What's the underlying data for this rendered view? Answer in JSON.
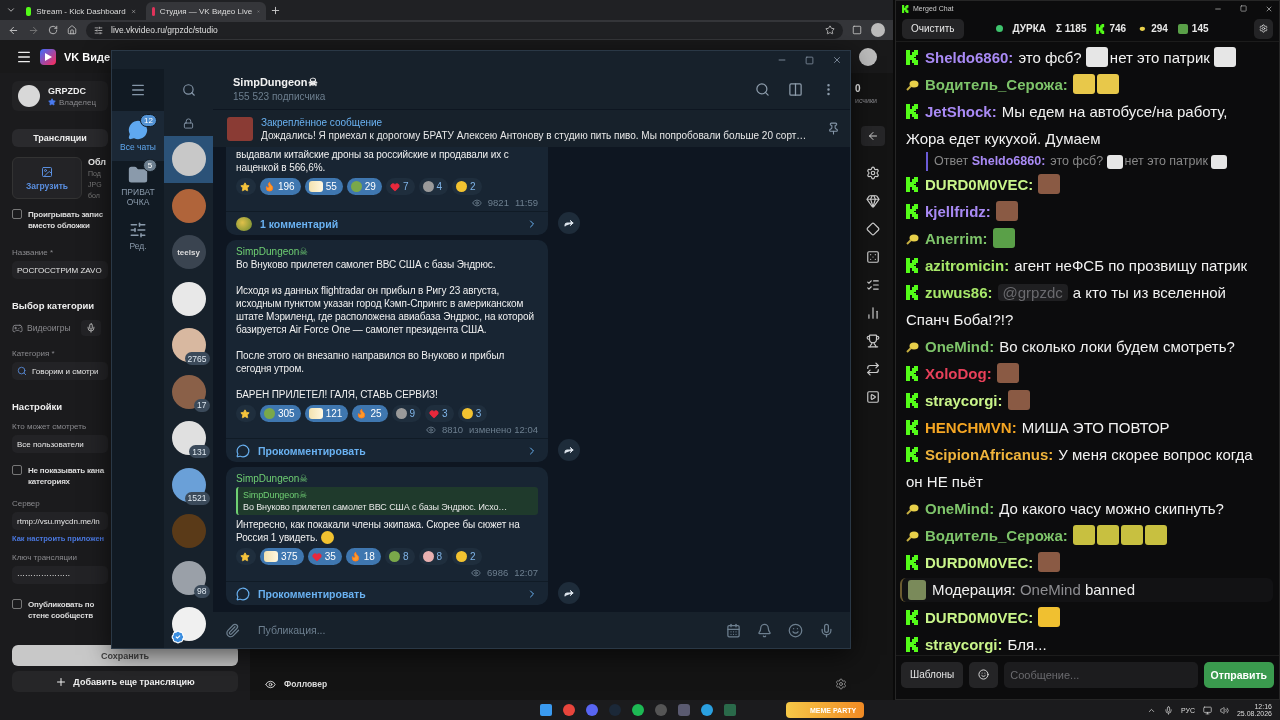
{
  "browser": {
    "tabs": [
      {
        "title": "Stream - Kick Dashboard",
        "kind": "kick",
        "selected": false
      },
      {
        "title": "Студия — VK Видео Live",
        "kind": "vk",
        "selected": true
      }
    ],
    "url": "live.vkvideo.ru/grpzdc/studio"
  },
  "vk": {
    "logo_text": "VK Виде",
    "user": {
      "name": "GRPZDC",
      "role": "Владелец"
    },
    "tab": "Трансляции",
    "upload": {
      "button": "Загрузить",
      "title": "Обл",
      "hint_lines": [
        "Под",
        "JPG",
        "бол"
      ]
    },
    "play_record": {
      "lines": [
        "Проигрывать запис",
        "вместо обложки"
      ],
      "checked": false
    },
    "name_label": "Название *",
    "name_value": "РОСГОССТРИМ ZAVO",
    "category_heading": "Выбор категории",
    "category_type": "Видеоигры",
    "category_label": "Категория *",
    "category_value": "Говорим и смотри",
    "settings_heading": "Настройки",
    "viewers_label": "Кто может смотреть",
    "viewers_value": "Все пользователи",
    "hide_channel": {
      "lines": [
        "Не показывать кана",
        "категориях"
      ],
      "checked": false
    },
    "server_label": "Сервер",
    "server_value": "rtmp://vsu.mycdn.me/in",
    "setup_link": "Как настроить приложен",
    "key_label": "Ключ трансляции",
    "key_value": "····················",
    "publish": {
      "lines": [
        "Опубликовать по",
        "стене сообществ"
      ],
      "checked": false
    },
    "save": "Сохранить",
    "add": "Добавить еще трансляцию",
    "stat_value": "0",
    "stat_label": "исчики",
    "follower": "Фолловер"
  },
  "telegram": {
    "folders": [
      {
        "label": "Все чаты",
        "badge": "12",
        "kind": "chats",
        "selected": true
      },
      {
        "label": "ПРИВАТ ОЧКА",
        "badge": "5",
        "kind": "folder",
        "selected": false
      },
      {
        "label": "Ред.",
        "kind": "edit",
        "selected": false
      }
    ],
    "chats": [
      {
        "selected": true
      },
      {
        "selected": false
      },
      {
        "selected": false,
        "text": "teelsy"
      },
      {
        "selected": false
      },
      {
        "selected": false,
        "badge": "2765"
      },
      {
        "selected": false,
        "badge": "17"
      },
      {
        "selected": false,
        "badge": "131"
      },
      {
        "selected": false,
        "badge": "1521"
      },
      {
        "selected": false
      },
      {
        "selected": false,
        "badge": "98"
      },
      {
        "selected": false,
        "verified": true
      }
    ],
    "channel": {
      "name": "SimpDungeon☠",
      "subscribers": "155 523 подписчика"
    },
    "pinned": {
      "title": "Закреплённое сообщение",
      "text": "Дождались!   Я приехал к дорогому БРАТУ Алексею Антонову в студию пить пиво. Мы попробовали больше 20 сорт…"
    },
    "posts": [
      {
        "continued": true,
        "paragraphs": [
          "выдавали китайские дроны за российские и продавали их с наценкой в 566,6%."
        ],
        "reactions": [
          {
            "kind": "star",
            "selected": false
          },
          {
            "kind": "fire",
            "count": "196",
            "selected": true
          },
          {
            "kind": "sticker",
            "count": "55",
            "selected": true
          },
          {
            "kind": "pepe",
            "count": "29",
            "selected": true
          },
          {
            "kind": "heart",
            "count": "7",
            "selected": false
          },
          {
            "kind": "face",
            "count": "4",
            "selected": false
          },
          {
            "kind": "cry",
            "count": "2",
            "selected": false
          }
        ],
        "views": "9821",
        "time": "11:59",
        "comment": {
          "kind": "count",
          "label": "1 комментарий"
        }
      },
      {
        "continued": false,
        "author": "SimpDungeon☠",
        "paragraphs": [
          "Во Внуково прилетел самолет ВВС США с базы Эндрюс.",
          "Исходя из данных flightradar он прибыл в Ригу 23 августа, исходным пунктом указан город Кэмп-Спрингс в американском штате Мэриленд, где расположена авиабаза Эндрюс, на которой базируется Air Force One — самолет президента США.",
          "После этого он внезапно направился во Внуково и прибыл сегодня утром.",
          "БАРЕН ПРИЛЕТЕЛ! ГАЛЯ, СТАВЬ СЕРВИЗ!"
        ],
        "reactions": [
          {
            "kind": "star",
            "selected": false
          },
          {
            "kind": "pepe",
            "count": "305",
            "selected": true
          },
          {
            "kind": "sticker",
            "count": "121",
            "selected": true
          },
          {
            "kind": "fire",
            "count": "25",
            "selected": true
          },
          {
            "kind": "face",
            "count": "9",
            "selected": false
          },
          {
            "kind": "heart",
            "count": "3",
            "selected": false
          },
          {
            "kind": "cry",
            "count": "3",
            "selected": false
          }
        ],
        "views": "8810",
        "time": "изменено 12:04",
        "comment": {
          "kind": "prompt",
          "label": "Прокомментировать"
        }
      },
      {
        "continued": false,
        "author": "SimpDungeon☠",
        "reply": {
          "author": "SimpDungeon☠",
          "text": "Во Внуково прилетел самолет ВВС США с базы Эндрюс.  Исхо…"
        },
        "paragraphs": [
          "Интересно, как покакали члены экипажа. Скорее бы сюжет на Россия 1 увидеть."
        ],
        "trailing_emoji": true,
        "reactions": [
          {
            "kind": "star",
            "selected": false
          },
          {
            "kind": "sticker",
            "count": "375",
            "selected": true
          },
          {
            "kind": "heart",
            "count": "35",
            "selected": true
          },
          {
            "kind": "fire",
            "count": "18",
            "selected": true
          },
          {
            "kind": "pepe",
            "count": "8",
            "selected": false
          },
          {
            "kind": "pig",
            "count": "8",
            "selected": false
          },
          {
            "kind": "cry",
            "count": "2",
            "selected": false
          }
        ],
        "views": "6986",
        "time": "12:07",
        "comment": {
          "kind": "prompt",
          "label": "Прокомментировать"
        }
      }
    ],
    "composer_placeholder": "Публикация..."
  },
  "chat": {
    "title": "Merged Chat",
    "clear": "Очистить",
    "status": {
      "label": "ДУРКА",
      "live": true
    },
    "counts": [
      {
        "kind": "total",
        "text": "Σ 1185"
      },
      {
        "kind": "kick",
        "text": "746"
      },
      {
        "kind": "vk",
        "text": "294"
      },
      {
        "kind": "pepe",
        "text": "145"
      }
    ],
    "messages": [
      {
        "kind": "kick",
        "user": "Sheldo6860:",
        "color": "#a98af5",
        "parts": [
          {
            "kind": "text",
            "text": "это фсб?"
          },
          {
            "kind": "emote",
            "color": "#e6e6e6"
          },
          {
            "kind": "text",
            "text": "нет это патрик"
          },
          {
            "kind": "emote",
            "color": "#e6e6e6"
          }
        ]
      },
      {
        "kind": "vk",
        "user": "Водитель_Серожа:",
        "color": "#7ec46a",
        "parts": [
          {
            "kind": "emote",
            "color": "#e8c84a"
          },
          {
            "kind": "emote",
            "color": "#e8c84a"
          }
        ]
      },
      {
        "kind": "kick",
        "user": "JetShock:",
        "color": "#a98af5",
        "parts": [
          {
            "kind": "text",
            "text": "Мы едем на автобусе/на работу, Жора едет кукухой. Думаем"
          }
        ]
      },
      {
        "kind": "reply",
        "label": "Ответ",
        "user": "Sheldo6860:",
        "color": "#a98af5",
        "parts": [
          {
            "kind": "text",
            "text": "это фсб?"
          },
          {
            "kind": "emote",
            "color": "#e6e6e6"
          },
          {
            "kind": "text",
            "text": "нет это патрик"
          },
          {
            "kind": "emote",
            "color": "#e6e6e6"
          }
        ]
      },
      {
        "kind": "kick",
        "user": "DURD0M0VEC:",
        "color": "#c9f58a",
        "parts": [
          {
            "kind": "emote",
            "color": "#8a5a44"
          }
        ]
      },
      {
        "kind": "kick",
        "user": "kjellfridz:",
        "color": "#a98af5",
        "parts": [
          {
            "kind": "emote",
            "color": "#8a5a44"
          }
        ]
      },
      {
        "kind": "vk",
        "user": "Anerrim:",
        "color": "#7ec46a",
        "parts": [
          {
            "kind": "emote",
            "color": "#5aa048"
          }
        ]
      },
      {
        "kind": "kick",
        "user": "azitromicin:",
        "color": "#a8e86a",
        "parts": [
          {
            "kind": "text",
            "text": "агент неФСБ по прозвищу патрик"
          }
        ]
      },
      {
        "kind": "kick",
        "user": "zuwus86:",
        "color": "#a8e86a",
        "parts": [
          {
            "kind": "mention",
            "text": "@grpzdc"
          },
          {
            "kind": "text",
            "text": "а кто ты из вселенной Спанч Боба!?!?"
          }
        ]
      },
      {
        "kind": "vk",
        "user": "OneMind:",
        "color": "#7ec46a",
        "parts": [
          {
            "kind": "text",
            "text": "Во сколько локи будем смотреть?"
          }
        ]
      },
      {
        "kind": "kick",
        "user": "XoloDog:",
        "color": "#e8405a",
        "parts": [
          {
            "kind": "emote",
            "color": "#8a5a44"
          }
        ]
      },
      {
        "kind": "kick",
        "user": "straycorgi:",
        "color": "#c9f58a",
        "parts": [
          {
            "kind": "emote",
            "color": "#8a5a44"
          }
        ]
      },
      {
        "kind": "kick",
        "user": "HENCHMVN:",
        "color": "#f5a623",
        "parts": [
          {
            "kind": "text",
            "text": "МИША ЭТО ПОВТОР"
          }
        ]
      },
      {
        "kind": "kick",
        "user": "ScipionAfricanus:",
        "color": "#f0b43c",
        "parts": [
          {
            "kind": "text",
            "text": "У меня скорее вопрос когда он НЕ пьёт"
          }
        ]
      },
      {
        "kind": "vk",
        "user": "OneMind:",
        "color": "#7ec46a",
        "parts": [
          {
            "kind": "text",
            "text": "До какого часу можно скипнуть?"
          }
        ]
      },
      {
        "kind": "vk",
        "user": "Водитель_Серожа:",
        "color": "#7ec46a",
        "parts": [
          {
            "kind": "emote",
            "color": "#c8c040"
          },
          {
            "kind": "emote",
            "color": "#c8c040"
          },
          {
            "kind": "emote",
            "color": "#c8c040"
          },
          {
            "kind": "emote",
            "color": "#c8c040"
          }
        ]
      },
      {
        "kind": "kick",
        "user": "DURD0M0VEC:",
        "color": "#c9f58a",
        "parts": [
          {
            "kind": "emote",
            "color": "#8a5a44"
          }
        ]
      },
      {
        "kind": "moderation",
        "label": "Модерация:",
        "target": "OneMind",
        "action": "banned"
      },
      {
        "kind": "kick",
        "user": "DURD0M0VEC:",
        "color": "#c9f58a",
        "parts": [
          {
            "kind": "emote",
            "color": "#f0c030"
          }
        ]
      },
      {
        "kind": "kick",
        "user": "straycorgi:",
        "color": "#c9f58a",
        "parts": [
          {
            "kind": "text",
            "text": "Бля..."
          }
        ]
      }
    ],
    "templates": "Шаблоны",
    "placeholder": "Сообщение...",
    "send": "Отправить"
  },
  "taskbar": {
    "widget": "MEME PARTY",
    "lang": "РУС",
    "time": "12:16",
    "date": "25.08.2026"
  }
}
